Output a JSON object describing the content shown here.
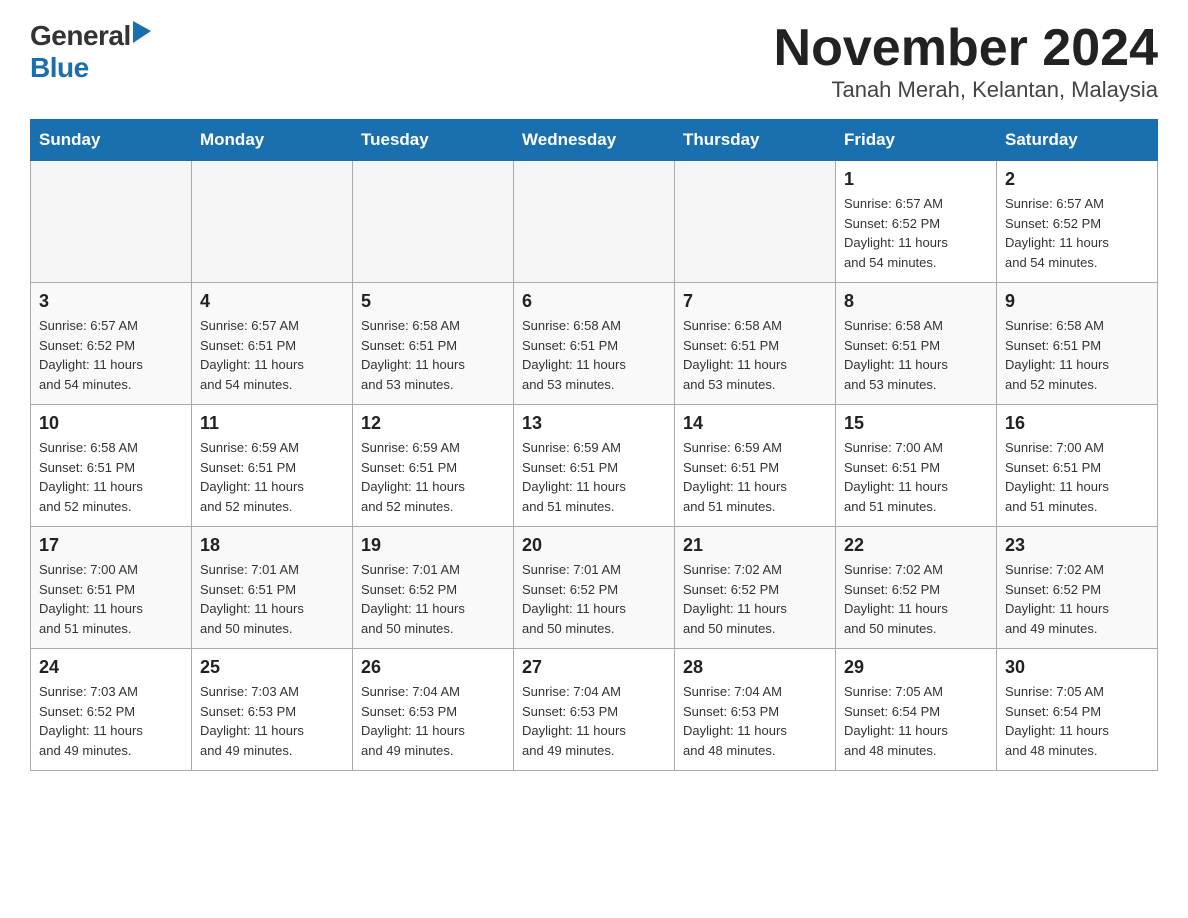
{
  "header": {
    "logo_general": "General",
    "logo_blue": "Blue",
    "title": "November 2024",
    "subtitle": "Tanah Merah, Kelantan, Malaysia"
  },
  "days_of_week": [
    "Sunday",
    "Monday",
    "Tuesday",
    "Wednesday",
    "Thursday",
    "Friday",
    "Saturday"
  ],
  "weeks": [
    {
      "days": [
        {
          "number": "",
          "info": ""
        },
        {
          "number": "",
          "info": ""
        },
        {
          "number": "",
          "info": ""
        },
        {
          "number": "",
          "info": ""
        },
        {
          "number": "",
          "info": ""
        },
        {
          "number": "1",
          "info": "Sunrise: 6:57 AM\nSunset: 6:52 PM\nDaylight: 11 hours\nand 54 minutes."
        },
        {
          "number": "2",
          "info": "Sunrise: 6:57 AM\nSunset: 6:52 PM\nDaylight: 11 hours\nand 54 minutes."
        }
      ]
    },
    {
      "days": [
        {
          "number": "3",
          "info": "Sunrise: 6:57 AM\nSunset: 6:52 PM\nDaylight: 11 hours\nand 54 minutes."
        },
        {
          "number": "4",
          "info": "Sunrise: 6:57 AM\nSunset: 6:51 PM\nDaylight: 11 hours\nand 54 minutes."
        },
        {
          "number": "5",
          "info": "Sunrise: 6:58 AM\nSunset: 6:51 PM\nDaylight: 11 hours\nand 53 minutes."
        },
        {
          "number": "6",
          "info": "Sunrise: 6:58 AM\nSunset: 6:51 PM\nDaylight: 11 hours\nand 53 minutes."
        },
        {
          "number": "7",
          "info": "Sunrise: 6:58 AM\nSunset: 6:51 PM\nDaylight: 11 hours\nand 53 minutes."
        },
        {
          "number": "8",
          "info": "Sunrise: 6:58 AM\nSunset: 6:51 PM\nDaylight: 11 hours\nand 53 minutes."
        },
        {
          "number": "9",
          "info": "Sunrise: 6:58 AM\nSunset: 6:51 PM\nDaylight: 11 hours\nand 52 minutes."
        }
      ]
    },
    {
      "days": [
        {
          "number": "10",
          "info": "Sunrise: 6:58 AM\nSunset: 6:51 PM\nDaylight: 11 hours\nand 52 minutes."
        },
        {
          "number": "11",
          "info": "Sunrise: 6:59 AM\nSunset: 6:51 PM\nDaylight: 11 hours\nand 52 minutes."
        },
        {
          "number": "12",
          "info": "Sunrise: 6:59 AM\nSunset: 6:51 PM\nDaylight: 11 hours\nand 52 minutes."
        },
        {
          "number": "13",
          "info": "Sunrise: 6:59 AM\nSunset: 6:51 PM\nDaylight: 11 hours\nand 51 minutes."
        },
        {
          "number": "14",
          "info": "Sunrise: 6:59 AM\nSunset: 6:51 PM\nDaylight: 11 hours\nand 51 minutes."
        },
        {
          "number": "15",
          "info": "Sunrise: 7:00 AM\nSunset: 6:51 PM\nDaylight: 11 hours\nand 51 minutes."
        },
        {
          "number": "16",
          "info": "Sunrise: 7:00 AM\nSunset: 6:51 PM\nDaylight: 11 hours\nand 51 minutes."
        }
      ]
    },
    {
      "days": [
        {
          "number": "17",
          "info": "Sunrise: 7:00 AM\nSunset: 6:51 PM\nDaylight: 11 hours\nand 51 minutes."
        },
        {
          "number": "18",
          "info": "Sunrise: 7:01 AM\nSunset: 6:51 PM\nDaylight: 11 hours\nand 50 minutes."
        },
        {
          "number": "19",
          "info": "Sunrise: 7:01 AM\nSunset: 6:52 PM\nDaylight: 11 hours\nand 50 minutes."
        },
        {
          "number": "20",
          "info": "Sunrise: 7:01 AM\nSunset: 6:52 PM\nDaylight: 11 hours\nand 50 minutes."
        },
        {
          "number": "21",
          "info": "Sunrise: 7:02 AM\nSunset: 6:52 PM\nDaylight: 11 hours\nand 50 minutes."
        },
        {
          "number": "22",
          "info": "Sunrise: 7:02 AM\nSunset: 6:52 PM\nDaylight: 11 hours\nand 50 minutes."
        },
        {
          "number": "23",
          "info": "Sunrise: 7:02 AM\nSunset: 6:52 PM\nDaylight: 11 hours\nand 49 minutes."
        }
      ]
    },
    {
      "days": [
        {
          "number": "24",
          "info": "Sunrise: 7:03 AM\nSunset: 6:52 PM\nDaylight: 11 hours\nand 49 minutes."
        },
        {
          "number": "25",
          "info": "Sunrise: 7:03 AM\nSunset: 6:53 PM\nDaylight: 11 hours\nand 49 minutes."
        },
        {
          "number": "26",
          "info": "Sunrise: 7:04 AM\nSunset: 6:53 PM\nDaylight: 11 hours\nand 49 minutes."
        },
        {
          "number": "27",
          "info": "Sunrise: 7:04 AM\nSunset: 6:53 PM\nDaylight: 11 hours\nand 49 minutes."
        },
        {
          "number": "28",
          "info": "Sunrise: 7:04 AM\nSunset: 6:53 PM\nDaylight: 11 hours\nand 48 minutes."
        },
        {
          "number": "29",
          "info": "Sunrise: 7:05 AM\nSunset: 6:54 PM\nDaylight: 11 hours\nand 48 minutes."
        },
        {
          "number": "30",
          "info": "Sunrise: 7:05 AM\nSunset: 6:54 PM\nDaylight: 11 hours\nand 48 minutes."
        }
      ]
    }
  ]
}
